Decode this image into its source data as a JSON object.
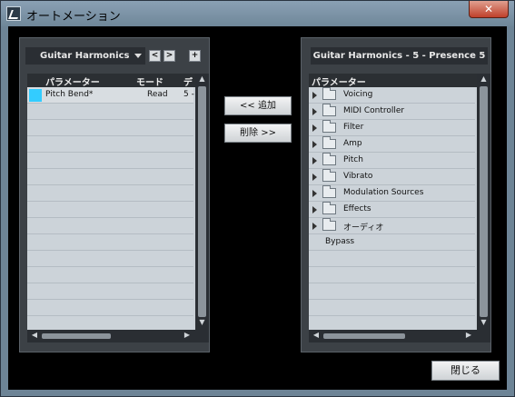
{
  "window": {
    "title": "オートメーション",
    "close_glyph": "✕"
  },
  "left_panel": {
    "dropdown_value": "Guitar Harmonics",
    "prev_label": "<",
    "next_label": ">",
    "add_label": "+",
    "columns": [
      "パラメーター",
      "モード",
      "デ"
    ],
    "rows": [
      {
        "color": "#33ccff",
        "parameter": "Pitch Bend*",
        "mode": "Read",
        "extra": "5 -"
      }
    ],
    "empty_row_count": 14
  },
  "middle": {
    "add_button": "<< 追加",
    "remove_button": "削除 >>"
  },
  "right_panel": {
    "title": "Guitar Harmonics - 5 - Presence 5",
    "column": "パラメーター",
    "folders": [
      "Voicing",
      "MIDI Controller",
      "Filter",
      "Amp",
      "Pitch",
      "Vibrato",
      "Modulation Sources",
      "Effects",
      "オーディオ"
    ],
    "leaf_items": [
      "Bypass"
    ],
    "empty_row_count": 5
  },
  "footer": {
    "close_button": "閉じる"
  }
}
